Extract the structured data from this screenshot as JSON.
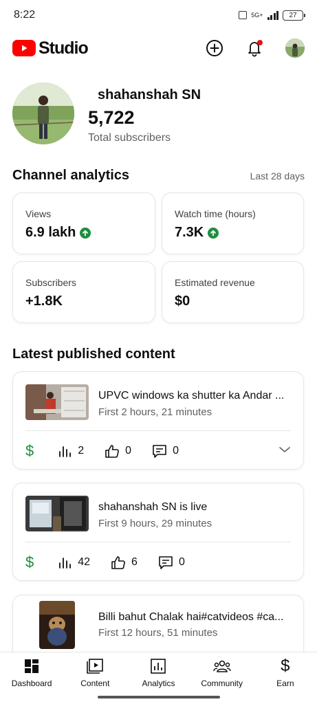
{
  "status_bar": {
    "time": "8:22",
    "network": "5G+",
    "battery": "27"
  },
  "header": {
    "logo_text": "Studio",
    "brand_color": "#ff0000"
  },
  "channel": {
    "name": "shahanshah SN",
    "subscribers": "5,722",
    "subscribers_label": "Total subscribers"
  },
  "analytics": {
    "title": "Channel analytics",
    "period": "Last 28 days",
    "metrics": [
      {
        "label": "Views",
        "value": "6.9 lakh",
        "trend": "up"
      },
      {
        "label": "Watch time (hours)",
        "value": "7.3K",
        "trend": "up"
      },
      {
        "label": "Subscribers",
        "value": "+1.8K",
        "trend": "none"
      },
      {
        "label": "Estimated revenue",
        "value": "$0",
        "trend": "none"
      }
    ]
  },
  "latest": {
    "title": "Latest published content",
    "items": [
      {
        "title": "UPVC windows ka shutter ka Andar ...",
        "time": "First 2 hours, 21 minutes",
        "views": "2",
        "likes": "0",
        "comments": "0"
      },
      {
        "title": "shahanshah SN is live",
        "time": "First 9 hours, 29 minutes",
        "views": "42",
        "likes": "6",
        "comments": "0"
      },
      {
        "title": "Billi bahut Chalak hai#catvideos #ca...",
        "time": "First 12 hours, 51 minutes"
      }
    ]
  },
  "nav": {
    "items": [
      {
        "label": "Dashboard",
        "icon": "dashboard-icon"
      },
      {
        "label": "Content",
        "icon": "content-icon"
      },
      {
        "label": "Analytics",
        "icon": "analytics-icon"
      },
      {
        "label": "Community",
        "icon": "community-icon"
      },
      {
        "label": "Earn",
        "icon": "earn-icon"
      }
    ]
  },
  "colors": {
    "positive": "#1e8e3e",
    "muted_text": "#606060",
    "notification_dot": "#e5111b"
  }
}
